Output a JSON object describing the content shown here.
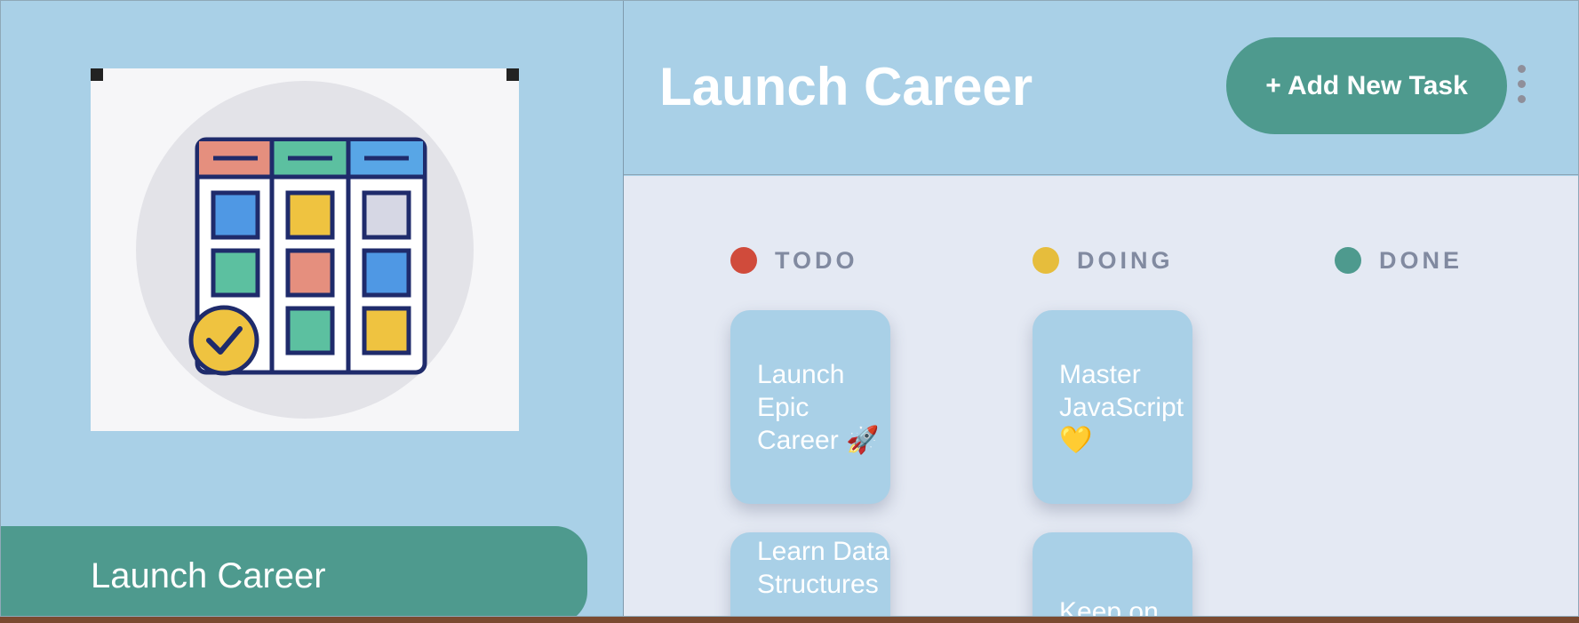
{
  "sidebar": {
    "board_name": "Launch Career"
  },
  "header": {
    "title": "Launch Career",
    "add_button_label": "+ Add New Task"
  },
  "columns": [
    {
      "name": "TODO",
      "color": "#d04b3b",
      "tasks": [
        "Launch Epic Career 🚀",
        "Learn Data Structures"
      ]
    },
    {
      "name": "DOING",
      "color": "#e6bd3c",
      "tasks": [
        "Master JavaScript 💛",
        "Keep on"
      ]
    },
    {
      "name": "DONE",
      "color": "#4e9a8e",
      "tasks": []
    }
  ],
  "colors": {
    "accent": "#4e9a8e",
    "panel": "#a9d0e7",
    "board_background": "#e4e9f3"
  }
}
